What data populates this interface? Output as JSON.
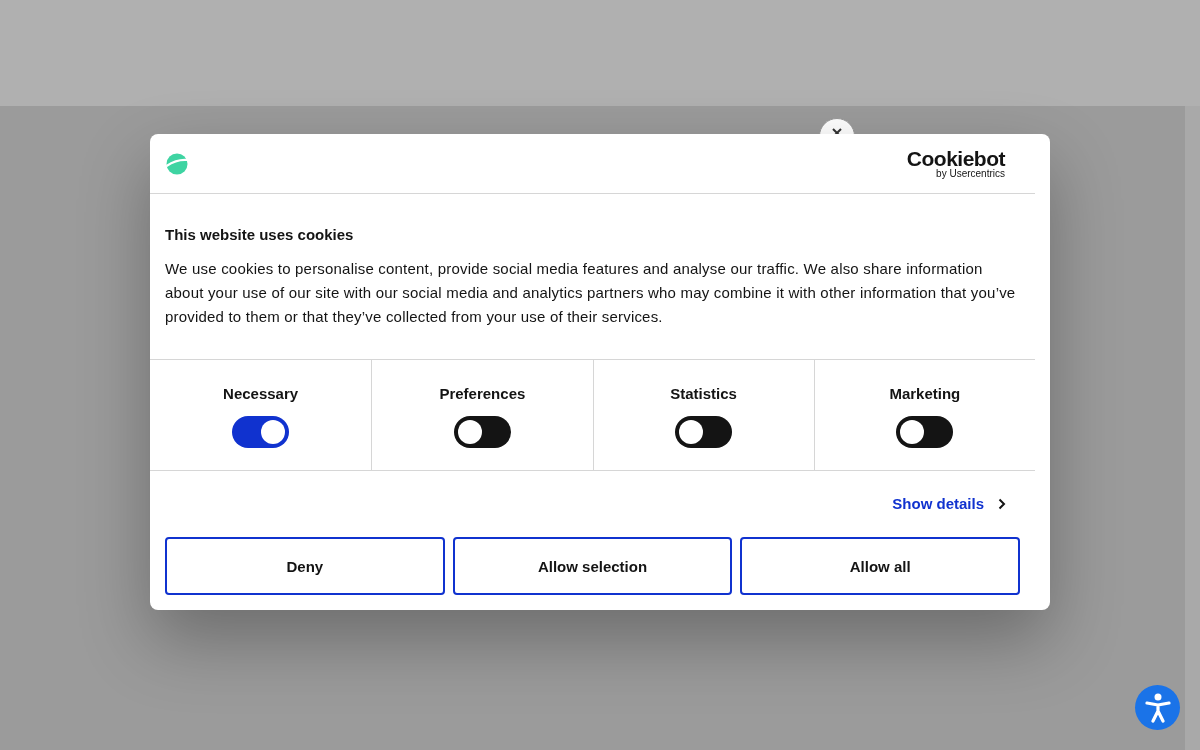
{
  "dialog": {
    "brand": {
      "name": "Cookiebot",
      "byline": "by Usercentrics"
    },
    "title": "This website uses cookies",
    "body": "We use cookies to personalise content, provide social media features and analyse our traffic. We also share information about your use of our site with our social media and analytics partners who may combine it with other information that you’ve provided to them or that they’ve collected from your use of their services.",
    "categories": [
      {
        "label": "Necessary",
        "checked": true
      },
      {
        "label": "Preferences",
        "checked": false
      },
      {
        "label": "Statistics",
        "checked": false
      },
      {
        "label": "Marketing",
        "checked": false
      }
    ],
    "details_link": "Show details",
    "buttons": [
      "Deny",
      "Allow selection",
      "Allow all"
    ]
  }
}
